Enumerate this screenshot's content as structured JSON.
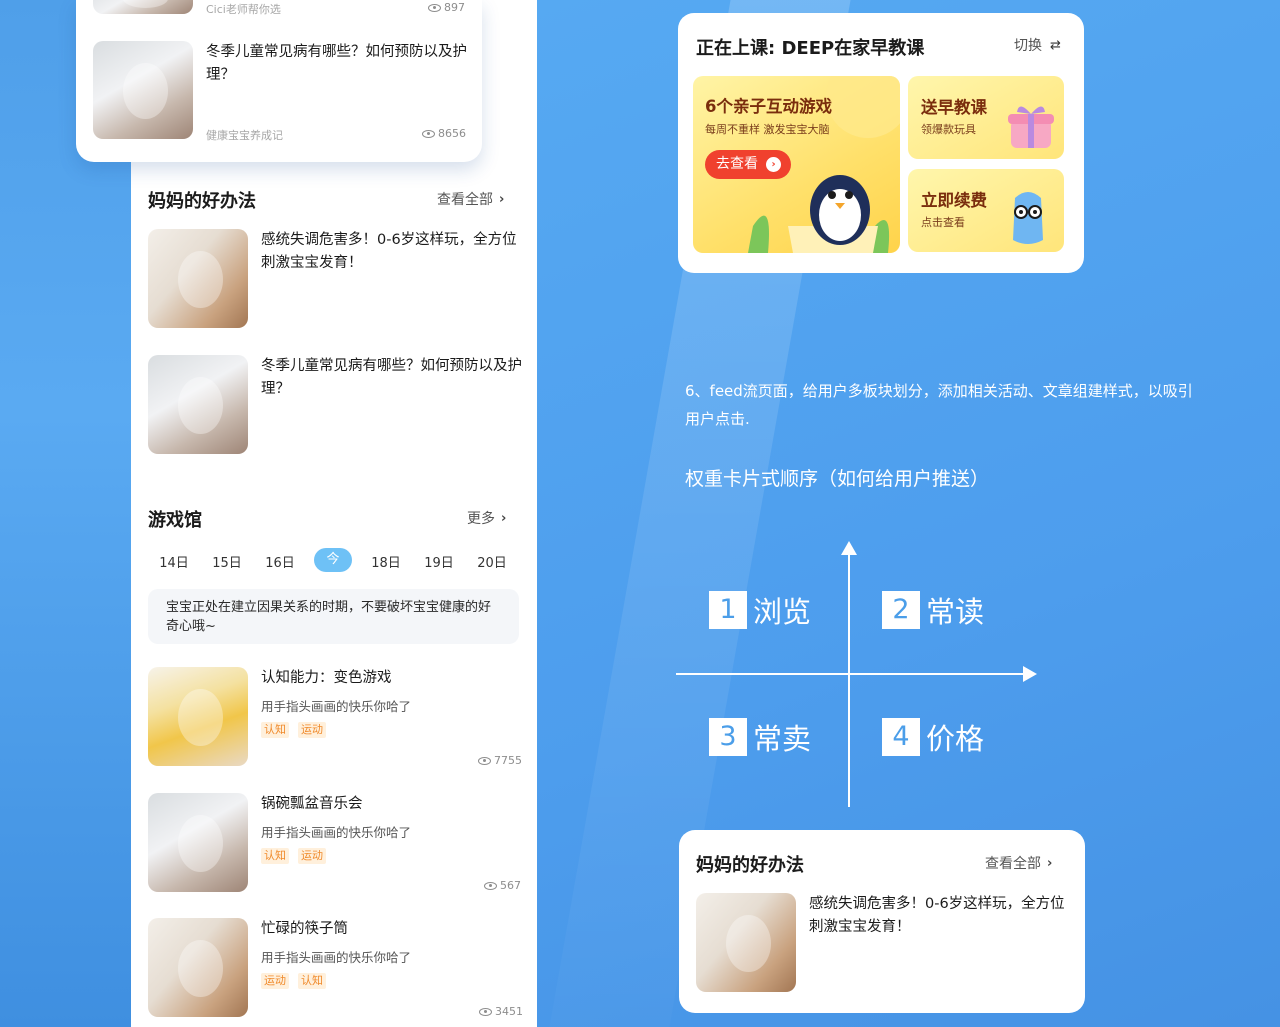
{
  "feed_top": {
    "first_item": {
      "source": "Cici老师帮你选",
      "views": "897"
    },
    "second_item": {
      "title": "冬季儿童常见病有哪些？如何预防以及护理？",
      "source": "健康宝宝养成记",
      "views": "8656"
    }
  },
  "moms_tips": {
    "title": "妈妈的好办法",
    "more_label": "查看全部",
    "items": [
      {
        "title": "感统失调危害多！0-6岁这样玩，全方位刺激宝宝发育！"
      },
      {
        "title": "冬季儿童常见病有哪些？如何预防以及护理？"
      }
    ]
  },
  "game_hall": {
    "title": "游戏馆",
    "more_label": "更多",
    "dates": [
      "14日",
      "15日",
      "16日",
      "今",
      "18日",
      "19日",
      "20日"
    ],
    "tip": "宝宝正处在建立因果关系的时期，不要破坏宝宝健康的好奇心哦~",
    "games": [
      {
        "title": "认知能力：变色游戏",
        "subtitle": "用手指头画画的快乐你哈了",
        "tags": [
          "认知",
          "运动"
        ],
        "views": "7755"
      },
      {
        "title": "锅碗瓢盆音乐会",
        "subtitle": "用手指头画画的快乐你哈了",
        "tags": [
          "认知",
          "运动"
        ],
        "views": "567"
      },
      {
        "title": "忙碌的筷子筒",
        "subtitle": "用手指头画画的快乐你哈了",
        "tags": [
          "运动",
          "认知"
        ],
        "views": "3451"
      }
    ]
  },
  "course": {
    "title": "正在上课: DEEP在家早教课",
    "switch_label": "切换",
    "big_promo": {
      "title": "6个亲子互动游戏",
      "subtitle": "每周不重样 激发宝宝大脑",
      "button": "去查看"
    },
    "promo_gift": {
      "title": "送早教课",
      "subtitle": "领爆款玩具"
    },
    "promo_renew": {
      "title": "立即续费",
      "subtitle": "点击查看"
    }
  },
  "annotation": {
    "note": "6、feed流页面，给用户多板块划分，添加相关活动、文章组建样式，以吸引用户点击.",
    "order_heading": "权重卡片式顺序（如何给用户推送）",
    "quadrants": [
      {
        "num": "1",
        "label": "浏览"
      },
      {
        "num": "2",
        "label": "常读"
      },
      {
        "num": "3",
        "label": "常卖"
      },
      {
        "num": "4",
        "label": "价格"
      }
    ]
  },
  "bottom_tips": {
    "title": "妈妈的好办法",
    "more_label": "查看全部",
    "item_title": "感统失调危害多！0-6岁这样玩，全方位刺激宝宝发育！"
  },
  "colors": {
    "accent": "#6ec1f6",
    "background": "#58a8f0",
    "promo_button": "#f0412e",
    "tag_text": "#f08a2b"
  }
}
